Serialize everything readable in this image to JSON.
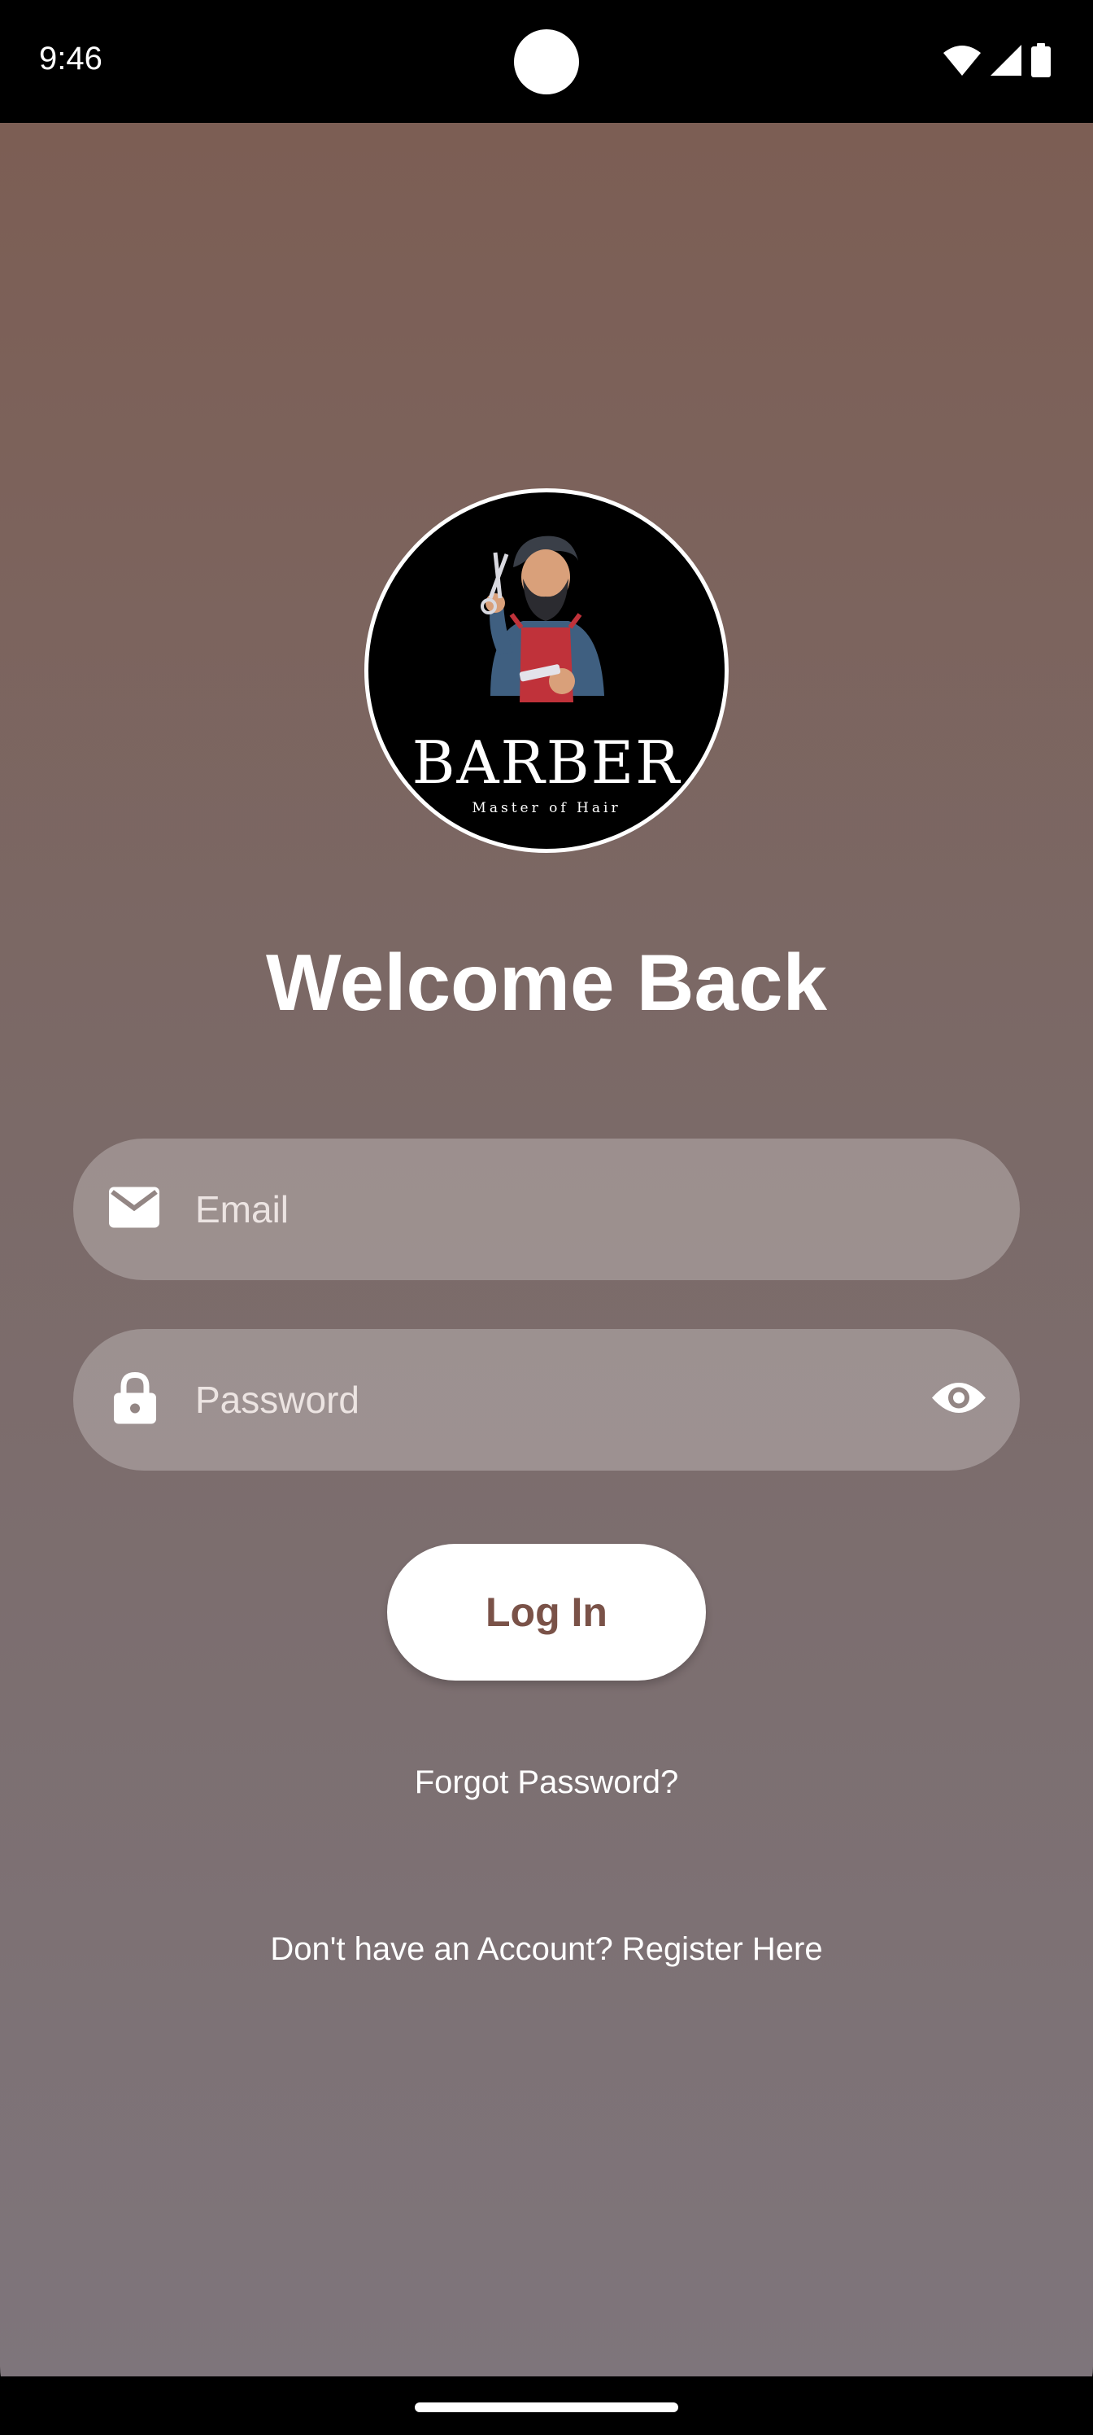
{
  "status_bar": {
    "time": "9:46",
    "icons": [
      "wifi-icon",
      "cell-signal-icon",
      "battery-icon"
    ]
  },
  "logo": {
    "brand": "BARBER",
    "tagline": "Master of Hair"
  },
  "title": "Welcome Back",
  "form": {
    "email_placeholder": "Email",
    "email_value": "",
    "password_placeholder": "Password",
    "password_value": "",
    "login_label": "Log In"
  },
  "links": {
    "forgot_password": "Forgot Password?",
    "register": "Don't have an Account? Register Here"
  },
  "colors": {
    "gradient_top": "#7c5e54",
    "gradient_bottom": "#7e757b",
    "button_text": "#7a5248"
  }
}
